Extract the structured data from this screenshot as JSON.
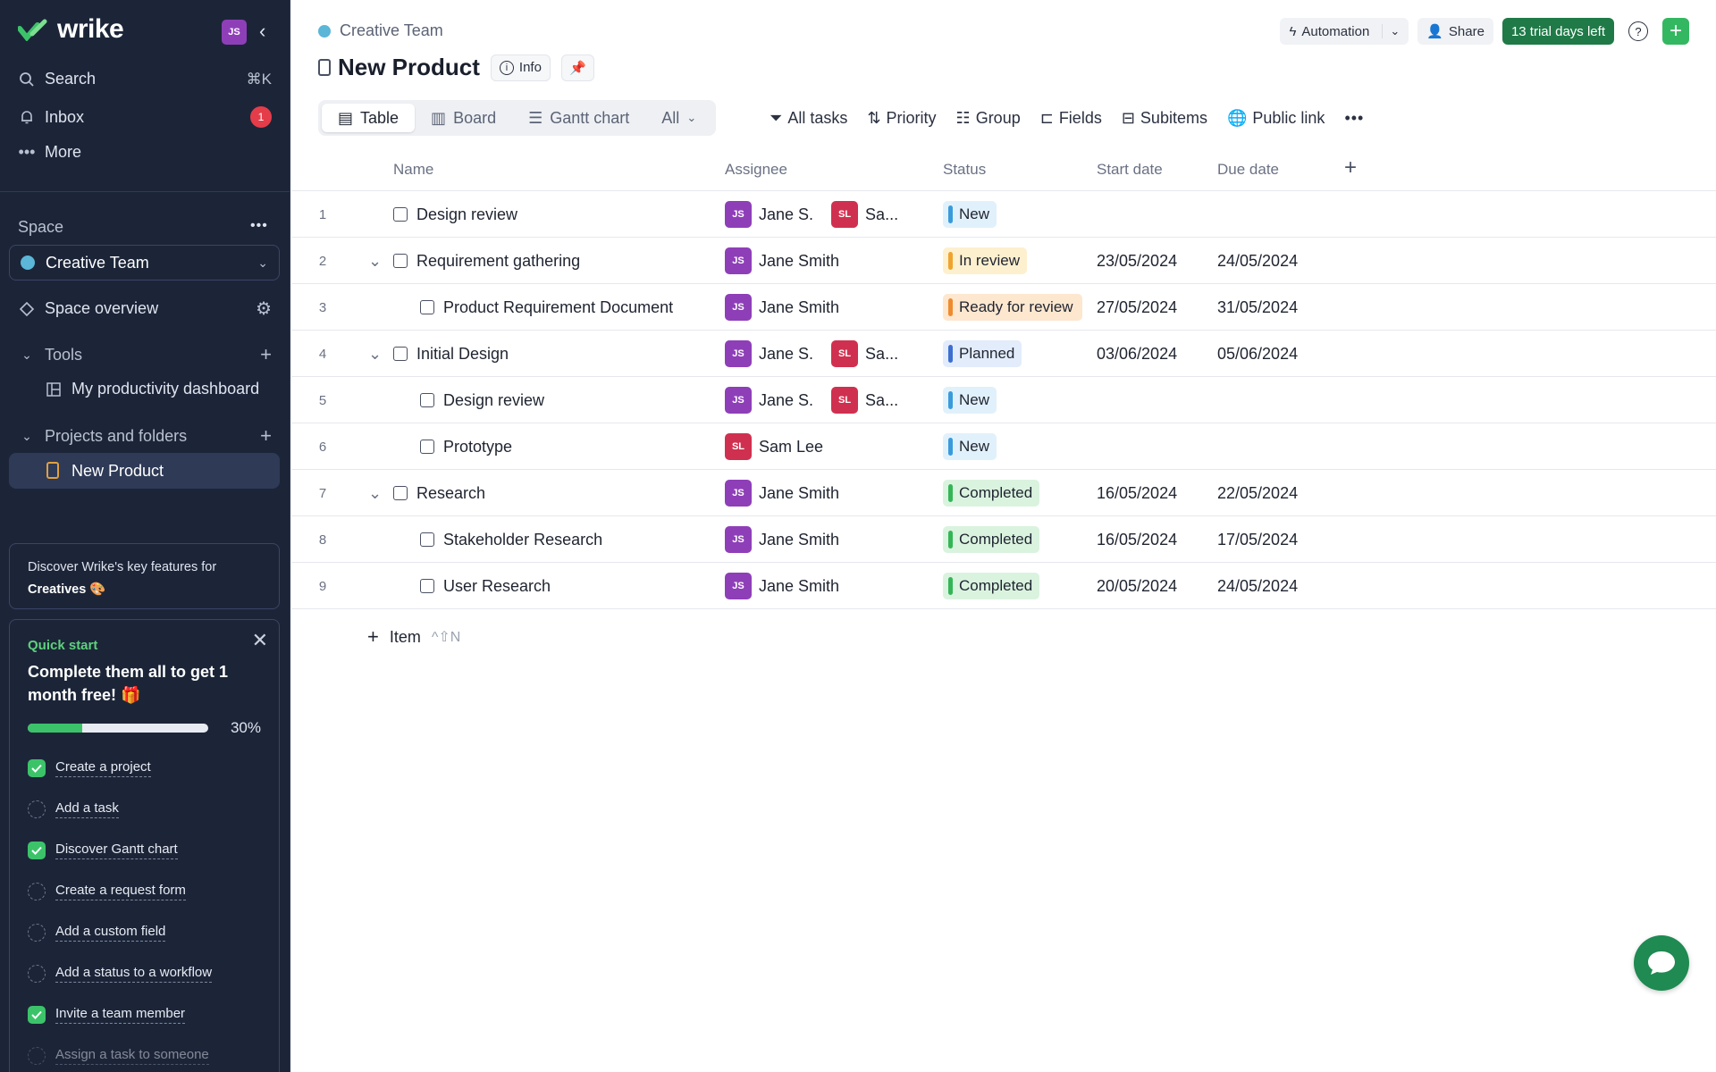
{
  "app": {
    "logo": "wrike",
    "user_initials": "JS"
  },
  "sidebar": {
    "search": {
      "label": "Search",
      "shortcut": "⌘K"
    },
    "inbox": {
      "label": "Inbox",
      "count": "1"
    },
    "more": {
      "label": "More"
    },
    "space_label": "Space",
    "space_name": "Creative Team",
    "space_overview": "Space overview",
    "tools_label": "Tools",
    "dashboard": "My productivity dashboard",
    "projects_label": "Projects and folders",
    "project": "New Product",
    "discover_line1": "Discover Wrike's key features for",
    "discover_line2": "Creatives 🎨",
    "quick_start": {
      "title": "Quick start",
      "heading": "Complete them all to get 1 month free! 🎁",
      "progress": 30,
      "progress_label": "30%",
      "items": [
        {
          "label": "Create a project",
          "done": true
        },
        {
          "label": "Add a task",
          "done": false
        },
        {
          "label": "Discover Gantt chart",
          "done": true
        },
        {
          "label": "Create a request form",
          "done": false
        },
        {
          "label": "Add a custom field",
          "done": false
        },
        {
          "label": "Add a status to a workflow",
          "done": false
        },
        {
          "label": "Invite a team member",
          "done": true
        },
        {
          "label": "Assign a task to someone",
          "done": false
        }
      ]
    }
  },
  "header": {
    "breadcrumb": "Creative Team",
    "title": "New Product",
    "info": "Info",
    "automation": "Automation",
    "share": "Share",
    "trial": "13 trial days left"
  },
  "views": {
    "table": "Table",
    "board": "Board",
    "gantt": "Gantt chart",
    "all": "All"
  },
  "toolbar": {
    "all_tasks": "All tasks",
    "priority": "Priority",
    "group": "Group",
    "fields": "Fields",
    "subitems": "Subitems",
    "public_link": "Public link"
  },
  "columns": {
    "name": "Name",
    "assignee": "Assignee",
    "status": "Status",
    "start": "Start date",
    "due": "Due date"
  },
  "rows": [
    {
      "num": "1",
      "name": "Design review",
      "indent": 0,
      "expand": false,
      "assignees": [
        {
          "i": "JS",
          "n": "Jane S."
        },
        {
          "i": "SL",
          "n": "Sa..."
        }
      ],
      "status": "New",
      "st": "new",
      "start": "",
      "due": ""
    },
    {
      "num": "2",
      "name": "Requirement gathering",
      "indent": 0,
      "expand": true,
      "assignees": [
        {
          "i": "JS",
          "n": "Jane Smith"
        }
      ],
      "status": "In review",
      "st": "review",
      "start": "23/05/2024",
      "due": "24/05/2024"
    },
    {
      "num": "3",
      "name": "Product Requirement Document",
      "indent": 1,
      "expand": false,
      "assignees": [
        {
          "i": "JS",
          "n": "Jane Smith"
        }
      ],
      "status": "Ready for review",
      "st": "ready",
      "start": "27/05/2024",
      "due": "31/05/2024"
    },
    {
      "num": "4",
      "name": "Initial Design",
      "indent": 0,
      "expand": true,
      "assignees": [
        {
          "i": "JS",
          "n": "Jane S."
        },
        {
          "i": "SL",
          "n": "Sa..."
        }
      ],
      "status": "Planned",
      "st": "planned",
      "start": "03/06/2024",
      "due": "05/06/2024"
    },
    {
      "num": "5",
      "name": "Design review",
      "indent": 1,
      "expand": false,
      "assignees": [
        {
          "i": "JS",
          "n": "Jane S."
        },
        {
          "i": "SL",
          "n": "Sa..."
        }
      ],
      "status": "New",
      "st": "new",
      "start": "",
      "due": ""
    },
    {
      "num": "6",
      "name": "Prototype",
      "indent": 1,
      "expand": false,
      "assignees": [
        {
          "i": "SL",
          "n": "Sam Lee"
        }
      ],
      "status": "New",
      "st": "new",
      "start": "",
      "due": ""
    },
    {
      "num": "7",
      "name": "Research",
      "indent": 0,
      "expand": true,
      "assignees": [
        {
          "i": "JS",
          "n": "Jane Smith"
        }
      ],
      "status": "Completed",
      "st": "done",
      "start": "16/05/2024",
      "due": "22/05/2024"
    },
    {
      "num": "8",
      "name": "Stakeholder Research",
      "indent": 1,
      "expand": false,
      "assignees": [
        {
          "i": "JS",
          "n": "Jane Smith"
        }
      ],
      "status": "Completed",
      "st": "done",
      "start": "16/05/2024",
      "due": "17/05/2024"
    },
    {
      "num": "9",
      "name": "User Research",
      "indent": 1,
      "expand": false,
      "assignees": [
        {
          "i": "JS",
          "n": "Jane Smith"
        }
      ],
      "status": "Completed",
      "st": "done",
      "start": "20/05/2024",
      "due": "24/05/2024"
    }
  ],
  "add_item": {
    "label": "Item",
    "shortcut": "^⇧N"
  },
  "colors": {
    "sidebar": "#1c2538",
    "accent_green": "#33b861",
    "trial": "#1f7a47"
  }
}
